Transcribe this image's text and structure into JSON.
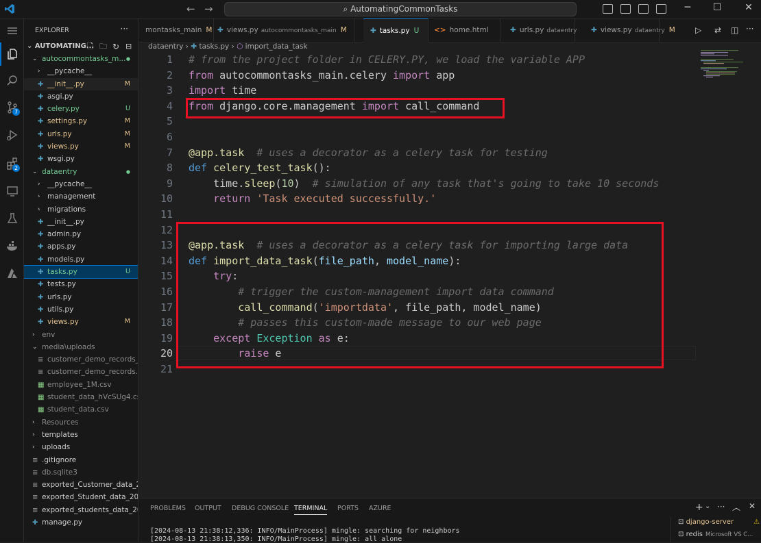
{
  "title_bar": {
    "search_text": "AutomatingCommonTasks"
  },
  "sidebar": {
    "header": "EXPLORER",
    "root": "AUTOMATING...",
    "tree": [
      {
        "label": "autocommontasks_m...",
        "indent": 1,
        "folder": true,
        "open": true,
        "dot": true,
        "cls": "c-unt"
      },
      {
        "label": "__pycache__",
        "indent": 2,
        "folder": true,
        "open": false,
        "cls": "c-def"
      },
      {
        "label": "__init__.py",
        "indent": 2,
        "py": true,
        "status": "M",
        "cls": "c-mod",
        "hl": true
      },
      {
        "label": "asgi.py",
        "indent": 2,
        "py": true,
        "cls": "c-def"
      },
      {
        "label": "celery.py",
        "indent": 2,
        "py": true,
        "status": "U",
        "cls": "c-unt"
      },
      {
        "label": "settings.py",
        "indent": 2,
        "py": true,
        "status": "M",
        "cls": "c-mod"
      },
      {
        "label": "urls.py",
        "indent": 2,
        "py": true,
        "status": "M",
        "cls": "c-mod"
      },
      {
        "label": "views.py",
        "indent": 2,
        "py": true,
        "status": "M",
        "cls": "c-mod"
      },
      {
        "label": "wsgi.py",
        "indent": 2,
        "py": true,
        "cls": "c-def"
      },
      {
        "label": "dataentry",
        "indent": 1,
        "folder": true,
        "open": true,
        "dot": true,
        "cls": "c-unt"
      },
      {
        "label": "__pycache__",
        "indent": 2,
        "folder": true,
        "open": false,
        "cls": "c-def"
      },
      {
        "label": "management",
        "indent": 2,
        "folder": true,
        "open": false,
        "cls": "c-def"
      },
      {
        "label": "migrations",
        "indent": 2,
        "folder": true,
        "open": false,
        "cls": "c-def"
      },
      {
        "label": "__init__.py",
        "indent": 2,
        "py": true,
        "cls": "c-def"
      },
      {
        "label": "admin.py",
        "indent": 2,
        "py": true,
        "cls": "c-def"
      },
      {
        "label": "apps.py",
        "indent": 2,
        "py": true,
        "cls": "c-def"
      },
      {
        "label": "models.py",
        "indent": 2,
        "py": true,
        "cls": "c-def"
      },
      {
        "label": "tasks.py",
        "indent": 2,
        "py": true,
        "status": "U",
        "cls": "c-unt",
        "selected": true
      },
      {
        "label": "tests.py",
        "indent": 2,
        "py": true,
        "cls": "c-def"
      },
      {
        "label": "urls.py",
        "indent": 2,
        "py": true,
        "cls": "c-def"
      },
      {
        "label": "utils.py",
        "indent": 2,
        "py": true,
        "cls": "c-def"
      },
      {
        "label": "views.py",
        "indent": 2,
        "py": true,
        "status": "M",
        "cls": "c-mod"
      },
      {
        "label": "env",
        "indent": 1,
        "folder": true,
        "open": false,
        "cls": "c-dim"
      },
      {
        "label": "media\\uploads",
        "indent": 1,
        "folder": true,
        "open": true,
        "cls": "c-dim"
      },
      {
        "label": "customer_demo_records_r...",
        "indent": 2,
        "file": true,
        "cls": "c-dim"
      },
      {
        "label": "customer_demo_records.c...",
        "indent": 2,
        "file": true,
        "cls": "c-dim"
      },
      {
        "label": "employee_1M.csv",
        "indent": 2,
        "file": true,
        "cls": "c-dim"
      },
      {
        "label": "student_data_hVcSUg4.csv",
        "indent": 2,
        "file": true,
        "cls": "c-dim"
      },
      {
        "label": "student_data.csv",
        "indent": 2,
        "file": true,
        "cls": "c-dim"
      },
      {
        "label": "Resources",
        "indent": 1,
        "folder": true,
        "open": false,
        "cls": "c-dim"
      },
      {
        "label": "templates",
        "indent": 1,
        "folder": true,
        "open": false,
        "cls": "c-def"
      },
      {
        "label": "uploads",
        "indent": 1,
        "folder": true,
        "open": false,
        "cls": "c-def"
      },
      {
        "label": ".gitignore",
        "indent": 1,
        "file": true,
        "cls": "c-def"
      },
      {
        "label": "db.sqlite3",
        "indent": 1,
        "file": true,
        "cls": "c-dim"
      },
      {
        "label": "exported_Customer_data_2...",
        "indent": 1,
        "file": true,
        "cls": "c-def"
      },
      {
        "label": "exported_Student_data_202...",
        "indent": 1,
        "file": true,
        "cls": "c-def"
      },
      {
        "label": "exported_students_data_20...",
        "indent": 1,
        "file": true,
        "cls": "c-def"
      },
      {
        "label": "manage.py",
        "indent": 1,
        "py": true,
        "cls": "c-def"
      }
    ]
  },
  "tabs": [
    {
      "label": "montasks_main",
      "sub": "",
      "status": "M"
    },
    {
      "label": "views.py",
      "sub": "autocommontasks_main",
      "status": "M"
    },
    {
      "label": "tasks.py",
      "sub": "",
      "status": "U",
      "active": true
    },
    {
      "label": "home.html",
      "sub": "",
      "status": ""
    },
    {
      "label": "urls.py",
      "sub": "dataentry",
      "status": ""
    },
    {
      "label": "views.py",
      "sub": "dataentry",
      "status": "M"
    }
  ],
  "breadcrumb": {
    "folder": "dataentry",
    "file": "tasks.py",
    "symbol": "import_data_task"
  },
  "code_lines": [
    [
      [
        "cmdim",
        "# from the project folder in CELERY.PY, we load the variable APP"
      ]
    ],
    [
      [
        "kw",
        "from"
      ],
      [
        "",
        " autocommontasks_main.celery "
      ],
      [
        "kw",
        "import"
      ],
      [
        "",
        " app"
      ]
    ],
    [
      [
        "kw",
        "import"
      ],
      [
        "",
        " time"
      ]
    ],
    [
      [
        "kw",
        "from"
      ],
      [
        "",
        " django.core.management "
      ],
      [
        "kw",
        "import"
      ],
      [
        "",
        " call_command"
      ]
    ],
    [],
    [],
    [
      [
        "fn",
        "@app.task"
      ],
      [
        "cmdim",
        "  # uses a decorator as a celery task for testing"
      ]
    ],
    [
      [
        "dk",
        "def"
      ],
      [
        "",
        " "
      ],
      [
        "fn",
        "celery_test_task"
      ],
      [
        "",
        "():"
      ]
    ],
    [
      [
        "",
        "    time."
      ],
      [
        "fn",
        "sleep"
      ],
      [
        "",
        "("
      ],
      [
        "num",
        "10"
      ],
      [
        "",
        ")"
      ],
      [
        "cmdim",
        "  # simulation of any task that's going to take 10 seconds"
      ]
    ],
    [
      [
        "",
        "    "
      ],
      [
        "kw",
        "return"
      ],
      [
        "",
        " "
      ],
      [
        "str",
        "'Task executed successfully.'"
      ]
    ],
    [],
    [],
    [
      [
        "fn",
        "@app.task"
      ],
      [
        "cmdim",
        "  # uses a decorator as a celery task for importing large data"
      ]
    ],
    [
      [
        "dk",
        "def"
      ],
      [
        "",
        " "
      ],
      [
        "fn",
        "import_data_task"
      ],
      [
        "",
        "("
      ],
      [
        "prm",
        "file_path"
      ],
      [
        "",
        ", "
      ],
      [
        "prm",
        "model_name"
      ],
      [
        "",
        "):"
      ]
    ],
    [
      [
        "",
        "    "
      ],
      [
        "kw",
        "try"
      ],
      [
        "",
        ":"
      ]
    ],
    [
      [
        "cmdim",
        "        # trigger the custom-management import data command"
      ]
    ],
    [
      [
        "",
        "        "
      ],
      [
        "fn",
        "call_command"
      ],
      [
        "",
        "("
      ],
      [
        "str",
        "'importdata'"
      ],
      [
        "",
        ", file_path, model_name)"
      ]
    ],
    [
      [
        "cmdim",
        "        # passes this custom-made message to our web page"
      ]
    ],
    [
      [
        "",
        "    "
      ],
      [
        "kw",
        "except"
      ],
      [
        "",
        " "
      ],
      [
        "cls",
        "Exception"
      ],
      [
        "",
        " "
      ],
      [
        "kw",
        "as"
      ],
      [
        "",
        " e:"
      ]
    ],
    [
      [
        "",
        "        "
      ],
      [
        "kw",
        "raise"
      ],
      [
        "",
        " e"
      ]
    ],
    []
  ],
  "current_line": 20,
  "panel": {
    "tabs": [
      "PROBLEMS",
      "OUTPUT",
      "DEBUG CONSOLE",
      "TERMINAL",
      "PORTS",
      "AZURE"
    ],
    "active_tab": "TERMINAL",
    "terminal_lines": [
      "[2024-08-13 21:38:12,336: INFO/MainProcess] mingle: searching for neighbors",
      "[2024-08-13 21:38:13,350: INFO/MainProcess] mingle: all alone"
    ],
    "terminals": [
      {
        "name": "django-server",
        "extra": ""
      },
      {
        "name": "redis",
        "extra": "Microsoft VS C..."
      }
    ]
  },
  "colors": {
    "accent": "#0078d4",
    "annotation": "#e81123",
    "modified": "#e2c08d",
    "untracked": "#73c991"
  }
}
